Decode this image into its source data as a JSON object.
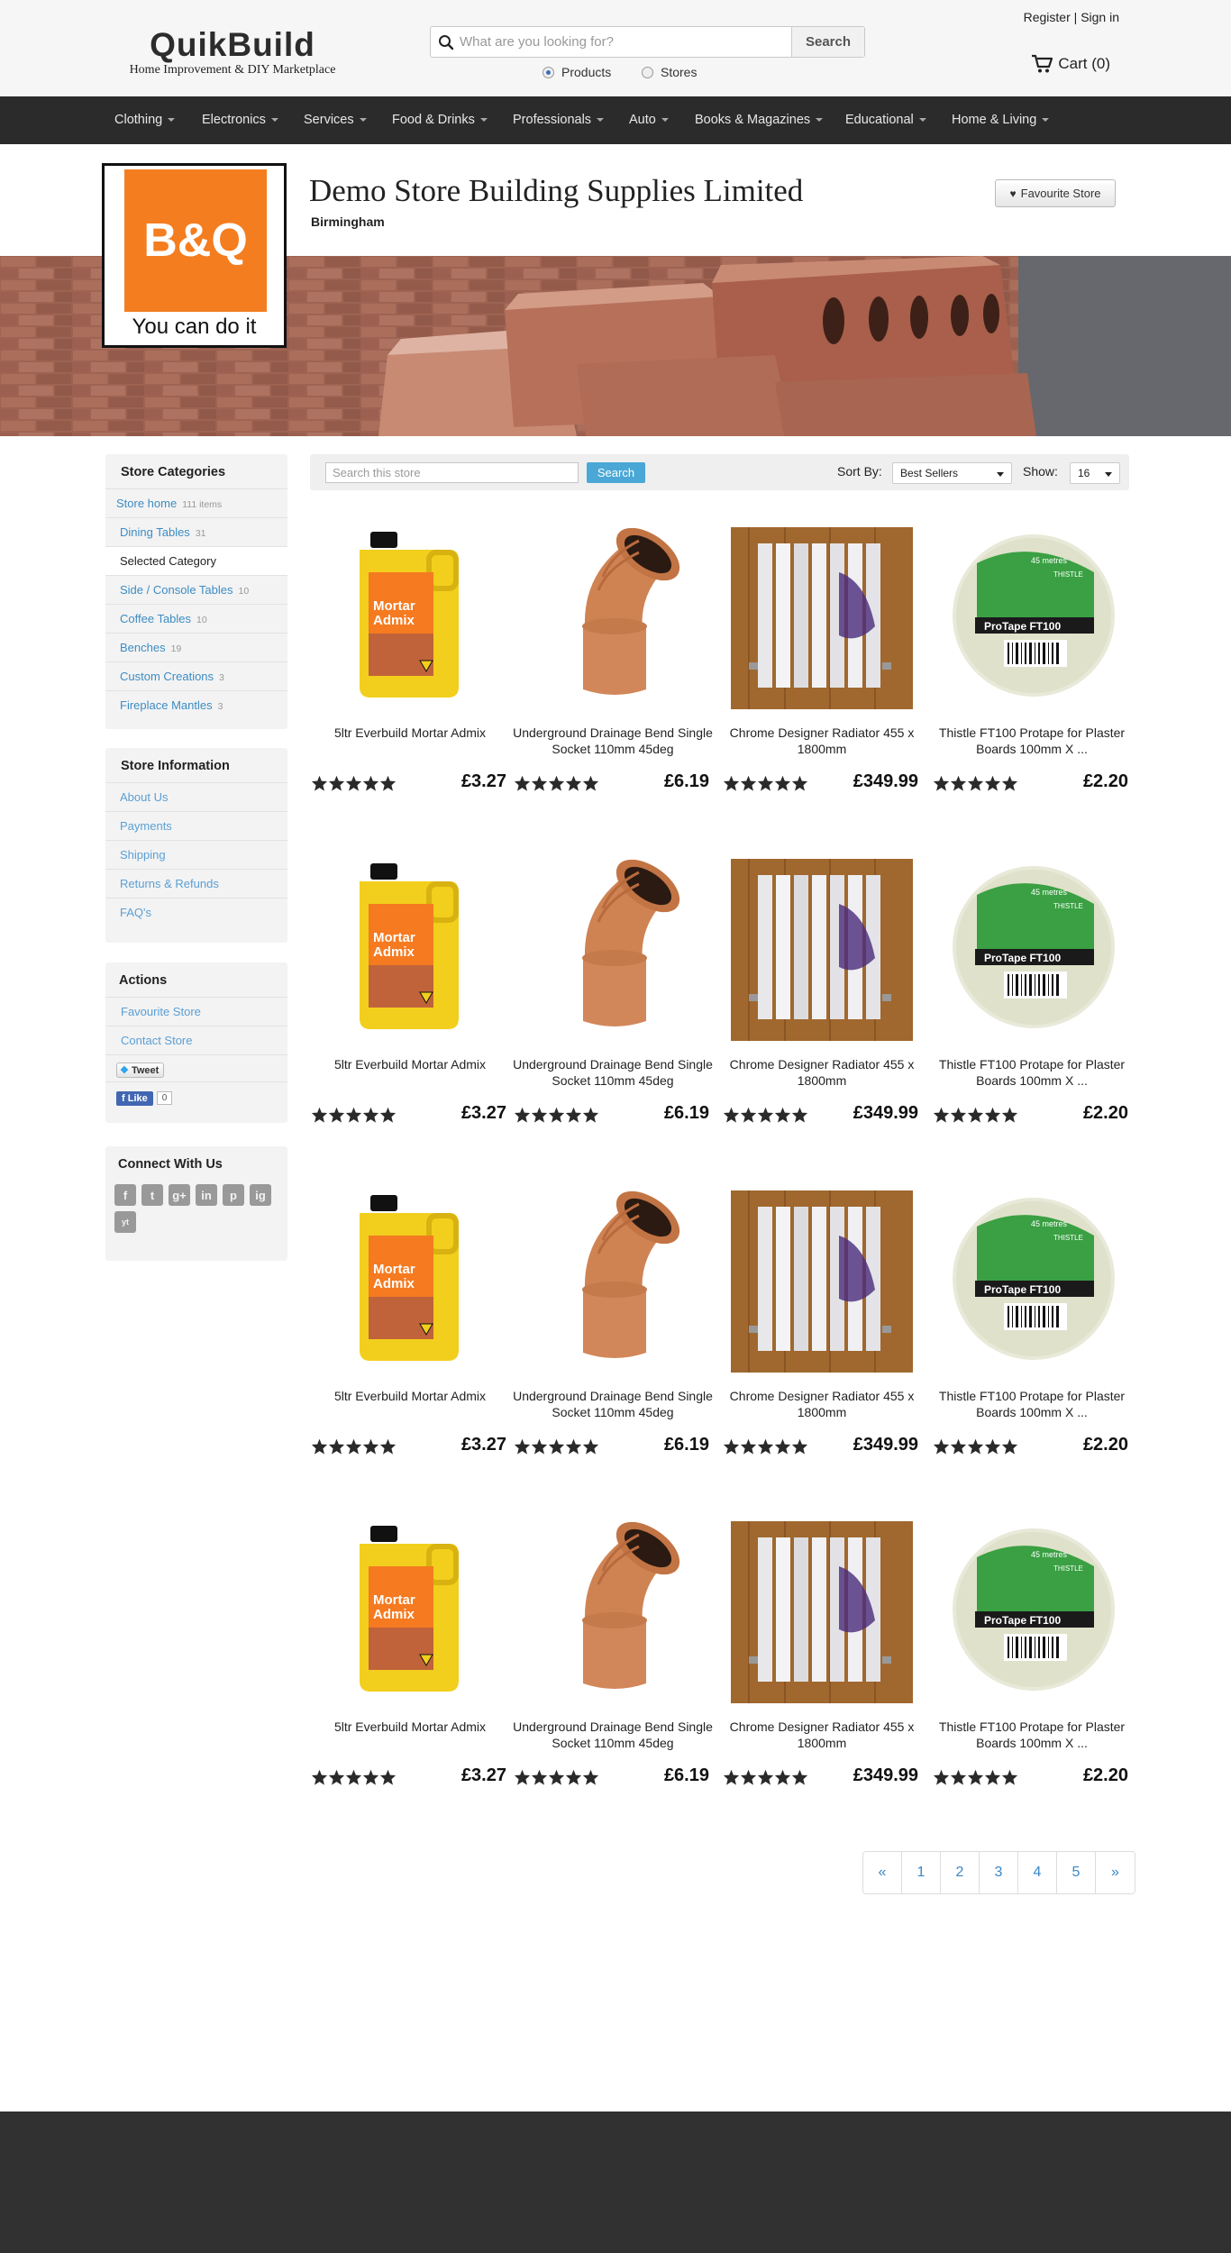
{
  "site": {
    "logo_title": "QuikBuild",
    "logo_subtitle": "Home Improvement & DIY Marketplace",
    "search_placeholder": "What are you looking for?",
    "search_button": "Search",
    "radio_products": "Products",
    "radio_stores": "Stores",
    "register": "Register",
    "sign_in": "Sign in",
    "auth_separator": "|",
    "cart_label": "Cart (0)"
  },
  "nav": [
    "Clothing",
    "Electronics",
    "Services",
    "Food & Drinks",
    "Professionals",
    "Auto",
    "Books & Magazines",
    "Educational",
    "Home & Living"
  ],
  "store": {
    "name": "Demo Store Building Supplies Limited",
    "city": "Birmingham",
    "logo_text": "B&Q",
    "logo_tagline": "You can do it",
    "favourite_button": "Favourite Store"
  },
  "sidebar": {
    "categories_title": "Store Categories",
    "categories": [
      {
        "label": "Store home",
        "count": "111 items"
      },
      {
        "label": "Dining Tables",
        "count": "31"
      },
      {
        "label": "Selected Category",
        "count": ""
      },
      {
        "label": "Side / Console Tables",
        "count": "10"
      },
      {
        "label": "Coffee Tables",
        "count": "10"
      },
      {
        "label": "Benches",
        "count": "19"
      },
      {
        "label": "Custom Creations",
        "count": "3"
      },
      {
        "label": "Fireplace Mantles",
        "count": "3"
      }
    ],
    "info_title": "Store Information",
    "info_links": [
      "About Us",
      "Payments",
      "Shipping",
      "Returns & Refunds",
      "FAQ's"
    ],
    "actions_title": "Actions",
    "action_links": [
      "Favourite Store",
      "Contact Store"
    ],
    "tweet_label": "Tweet",
    "like_label": "Like",
    "like_count": "0",
    "connect_title": "Connect With Us",
    "social_icons": [
      "f",
      "t",
      "g+",
      "in",
      "p",
      "ig",
      "yt"
    ]
  },
  "toolbar": {
    "search_placeholder": "Search this store",
    "search_button": "Search",
    "sort_label": "Sort By:",
    "sort_value": "Best Sellers",
    "show_label": "Show:",
    "show_value": "16"
  },
  "products": [
    {
      "name": "5ltr Everbuild Mortar Admix",
      "price": "£3.27",
      "rating": 5
    },
    {
      "name": "Underground Drainage Bend Single Socket 110mm 45deg",
      "price": "£6.19",
      "rating": 5
    },
    {
      "name": "Chrome Designer Radiator 455 x 1800mm",
      "price": "£349.99",
      "rating": 5
    },
    {
      "name": "Thistle FT100 Protape for Plaster Boards 100mm X ...",
      "price": "£2.20",
      "rating": 5
    },
    {
      "name": "5ltr Everbuild Mortar Admix",
      "price": "£3.27",
      "rating": 5
    },
    {
      "name": "Underground Drainage Bend Single Socket 110mm 45deg",
      "price": "£6.19",
      "rating": 5
    },
    {
      "name": "Chrome Designer Radiator 455 x 1800mm",
      "price": "£349.99",
      "rating": 5
    },
    {
      "name": "Thistle FT100 Protape for Plaster Boards 100mm X ...",
      "price": "£2.20",
      "rating": 5
    },
    {
      "name": "5ltr Everbuild Mortar Admix",
      "price": "£3.27",
      "rating": 5
    },
    {
      "name": "Underground Drainage Bend Single Socket 110mm 45deg",
      "price": "£6.19",
      "rating": 5
    },
    {
      "name": "Chrome Designer Radiator 455 x 1800mm",
      "price": "£349.99",
      "rating": 5
    },
    {
      "name": "Thistle FT100 Protape for Plaster Boards 100mm X ...",
      "price": "£2.20",
      "rating": 5
    },
    {
      "name": "5ltr Everbuild Mortar Admix",
      "price": "£3.27",
      "rating": 5
    },
    {
      "name": "Underground Drainage Bend Single Socket 110mm 45deg",
      "price": "£6.19",
      "rating": 5
    },
    {
      "name": "Chrome Designer Radiator 455 x 1800mm",
      "price": "£349.99",
      "rating": 5
    },
    {
      "name": "Thistle FT100 Protape for Plaster Boards 100mm X ...",
      "price": "£2.20",
      "rating": 5
    }
  ],
  "product_images": [
    "mortar-admix-bottle",
    "drainage-bend-pipe",
    "chrome-radiator",
    "protape-roll"
  ],
  "product_label_texts": {
    "mortar": "Mortar Admix",
    "tape_brand": "THISTLE",
    "tape_name": "ProTape FT100",
    "tape_length": "45 metres"
  },
  "pagination": [
    "«",
    "1",
    "2",
    "3",
    "4",
    "5",
    "»"
  ],
  "colors": {
    "nav_bg": "#2b2b2b",
    "link": "#3d8cc4",
    "brand_orange": "#f47d1f",
    "search_btn": "#4aa7d6",
    "footer_bg": "#313131"
  }
}
